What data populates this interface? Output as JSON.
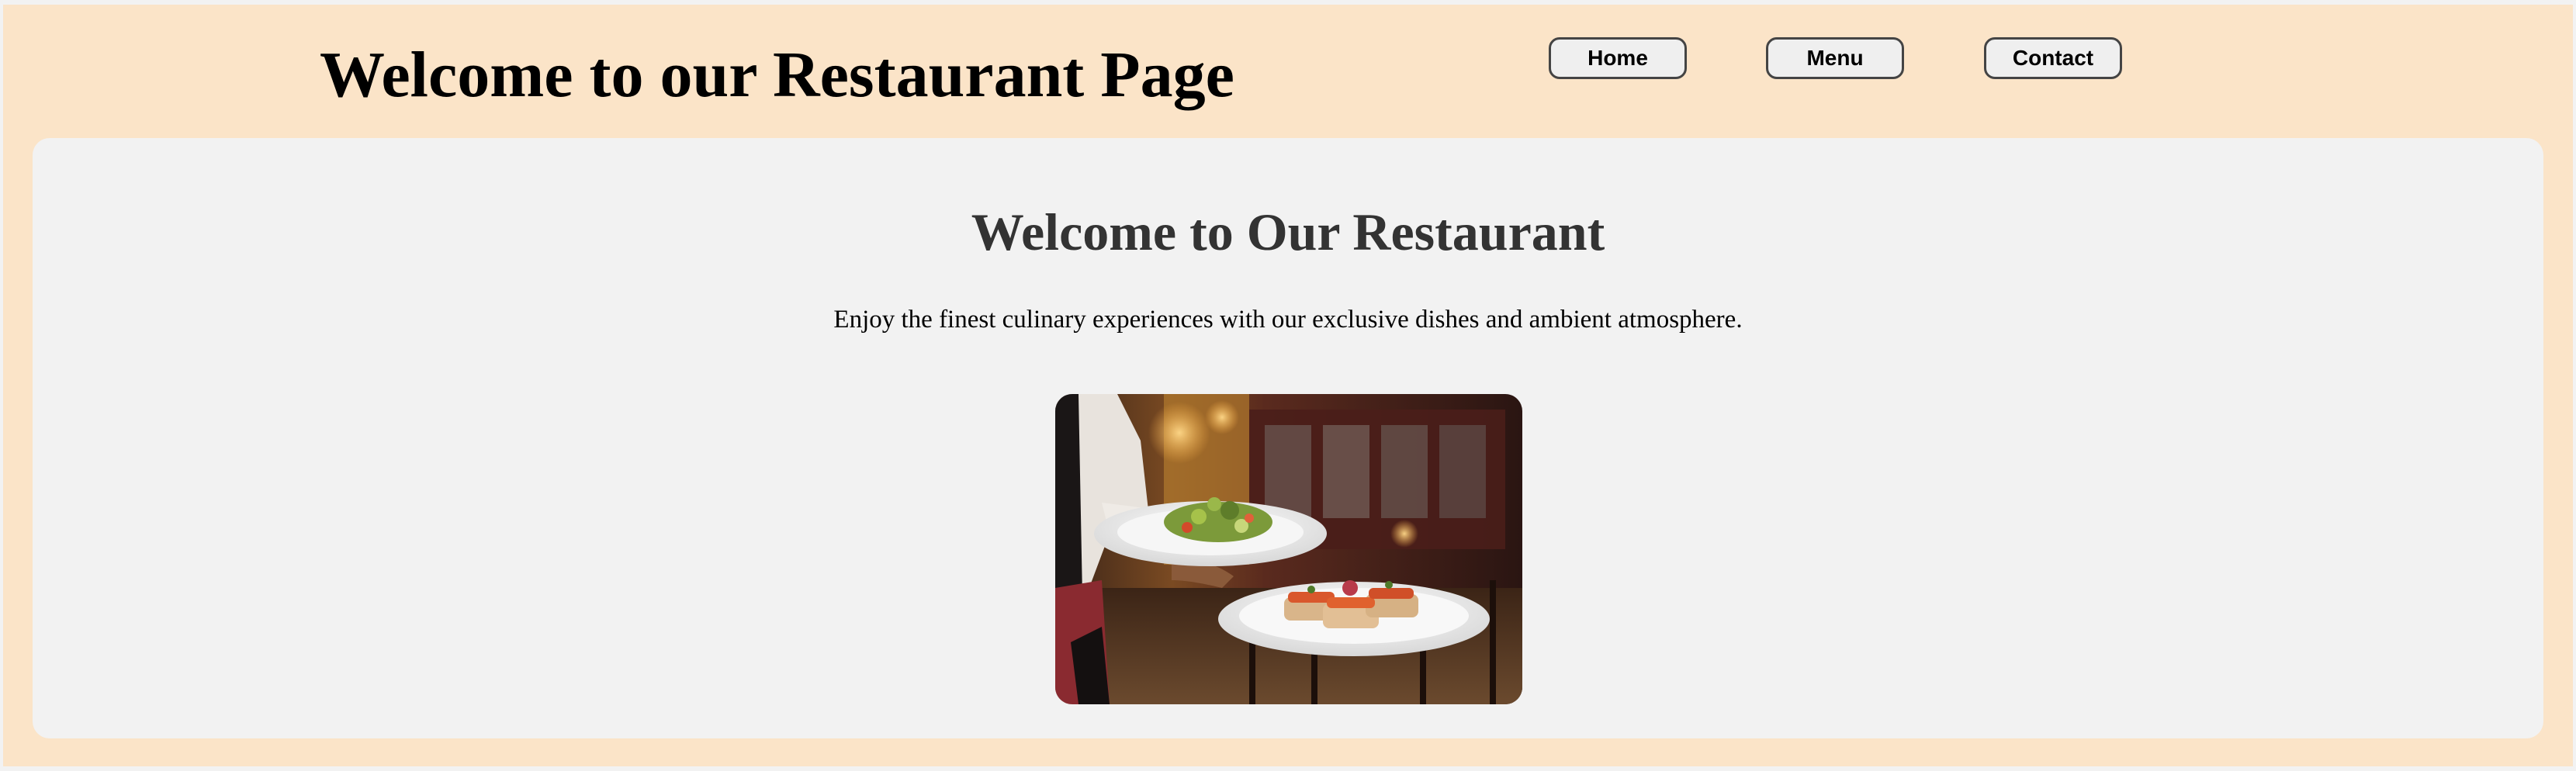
{
  "header": {
    "title": "Welcome to our Restaurant Page"
  },
  "nav": {
    "items": [
      {
        "label": "Home"
      },
      {
        "label": "Menu"
      },
      {
        "label": "Contact"
      }
    ]
  },
  "main": {
    "heading": "Welcome to Our Restaurant",
    "description": "Enjoy the finest culinary experiences with our exclusive dishes and ambient atmosphere.",
    "image": {
      "subject": "waiter carrying plates of salad and bruschetta in a restaurant"
    }
  },
  "colors": {
    "page_background": "#fbe4c8",
    "card_background": "#f2f2f2",
    "heading_text": "#333333",
    "button_background": "#efefef",
    "button_border": "#444444"
  }
}
